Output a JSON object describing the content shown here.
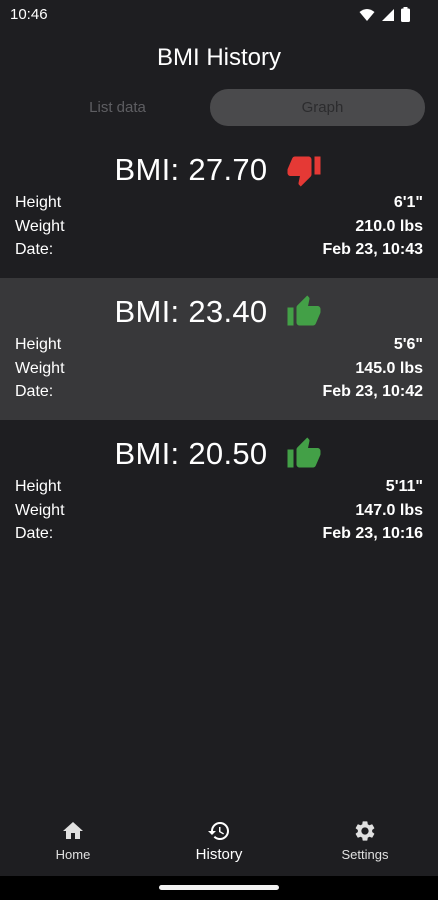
{
  "status_bar": {
    "time": "10:46"
  },
  "header": {
    "title": "BMI History"
  },
  "segmented": {
    "left_label": "List data",
    "right_label": "Graph"
  },
  "records": [
    {
      "bmi": "BMI: 27.70",
      "rating": "thumbs-down",
      "rating_color": "#e53935",
      "height_label": "Height",
      "height_value": "6'1\"",
      "weight_label": "Weight",
      "weight_value": "210.0 lbs",
      "date_label": "Date:",
      "date_value": "Feb 23, 10:43"
    },
    {
      "bmi": "BMI: 23.40",
      "rating": "thumbs-up",
      "rating_color": "#43a047",
      "height_label": "Height",
      "height_value": "5'6\"",
      "weight_label": "Weight",
      "weight_value": "145.0 lbs",
      "date_label": "Date:",
      "date_value": "Feb 23, 10:42"
    },
    {
      "bmi": "BMI: 20.50",
      "rating": "thumbs-up",
      "rating_color": "#43a047",
      "height_label": "Height",
      "height_value": "5'11\"",
      "weight_label": "Weight",
      "weight_value": "147.0 lbs",
      "date_label": "Date:",
      "date_value": "Feb 23, 10:16"
    }
  ],
  "bottom_nav": {
    "home_label": "Home",
    "history_label": "History",
    "settings_label": "Settings"
  }
}
